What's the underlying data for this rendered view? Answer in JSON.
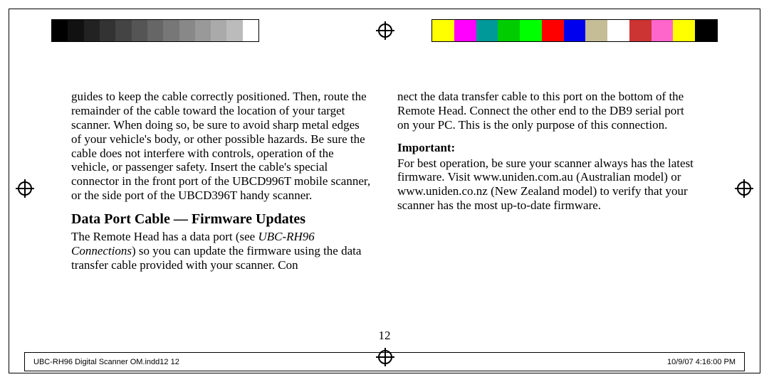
{
  "domain": "Document",
  "page_number": "12",
  "slug": {
    "left": "UBC-RH96 Digital Scanner OM.indd12   12",
    "right": "10/9/07   4:16:00 PM"
  },
  "content": {
    "para1": "guides to keep the cable correctly positioned. Then, route the remainder of the cable toward the location of your target scanner. When doing so, be sure to avoid sharp metal edges of your vehicle's body, or other possible hazards. Be sure the cable does not interfere with controls, operation of the vehicle, or passenger safety. Insert the cable's special connector in the front port of the UBCD996T mobile scanner, or the side port of the UBCD396T handy scanner.",
    "heading": "Data Port Cable — Firmware Updates",
    "para2_part1": "The Remote Head has a data port (see ",
    "para2_italic": "UBC-RH96 Connections",
    "para2_part2": ") so you can update the firmware using the data transfer cable provided with your scanner. Con­",
    "para3": "nect the data transfer cable to this port on the bottom of the Remote Head. Connect the other end to the DB9 serial port on your PC. This is the only purpose of this connection.",
    "important_label": "Important:",
    "important_text": "For best operation, be sure your scanner always has the latest firmware. Visit www.uniden.com.au (Australian model) or www.uniden.co.nz (New Zealand model) to verify that your scanner has the most up-to-date firmware."
  }
}
